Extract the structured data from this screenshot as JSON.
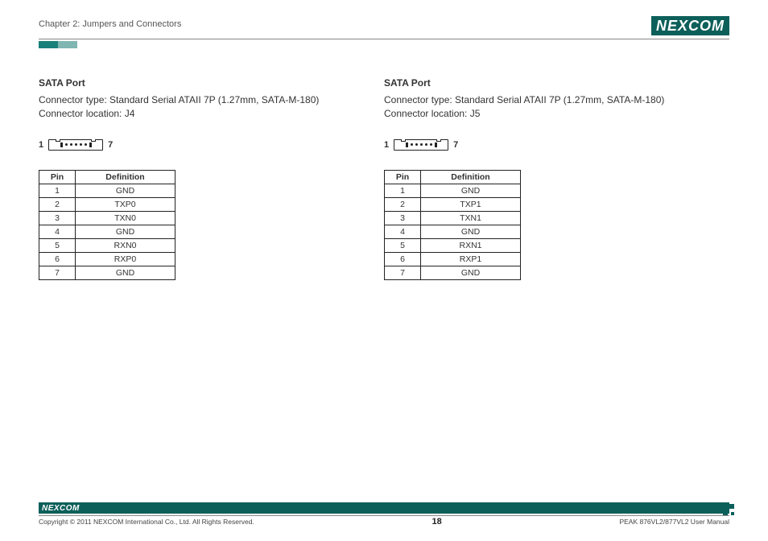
{
  "header": {
    "chapter": "Chapter 2: Jumpers and Connectors",
    "logo": "NEXCOM"
  },
  "left": {
    "title": "SATA Port",
    "type_line": "Connector type: Standard Serial ATAII 7P (1.27mm, SATA-M-180)",
    "location_line": "Connector location: J4",
    "pin_left": "1",
    "pin_right": "7",
    "table": {
      "headers": {
        "pin": "Pin",
        "def": "Definition"
      },
      "rows": [
        {
          "pin": "1",
          "def": "GND"
        },
        {
          "pin": "2",
          "def": "TXP0"
        },
        {
          "pin": "3",
          "def": "TXN0"
        },
        {
          "pin": "4",
          "def": "GND"
        },
        {
          "pin": "5",
          "def": "RXN0"
        },
        {
          "pin": "6",
          "def": "RXP0"
        },
        {
          "pin": "7",
          "def": "GND"
        }
      ]
    }
  },
  "right": {
    "title": "SATA Port",
    "type_line": "Connector type: Standard Serial ATAII 7P (1.27mm, SATA-M-180)",
    "location_line": "Connector location: J5",
    "pin_left": "1",
    "pin_right": "7",
    "table": {
      "headers": {
        "pin": "Pin",
        "def": "Definition"
      },
      "rows": [
        {
          "pin": "1",
          "def": "GND"
        },
        {
          "pin": "2",
          "def": "TXP1"
        },
        {
          "pin": "3",
          "def": "TXN1"
        },
        {
          "pin": "4",
          "def": "GND"
        },
        {
          "pin": "5",
          "def": "RXN1"
        },
        {
          "pin": "6",
          "def": "RXP1"
        },
        {
          "pin": "7",
          "def": "GND"
        }
      ]
    }
  },
  "footer": {
    "logo": "NEXCOM",
    "copyright": "Copyright © 2011 NEXCOM International Co., Ltd. All Rights Reserved.",
    "page": "18",
    "manual": "PEAK 876VL2/877VL2 User Manual"
  }
}
